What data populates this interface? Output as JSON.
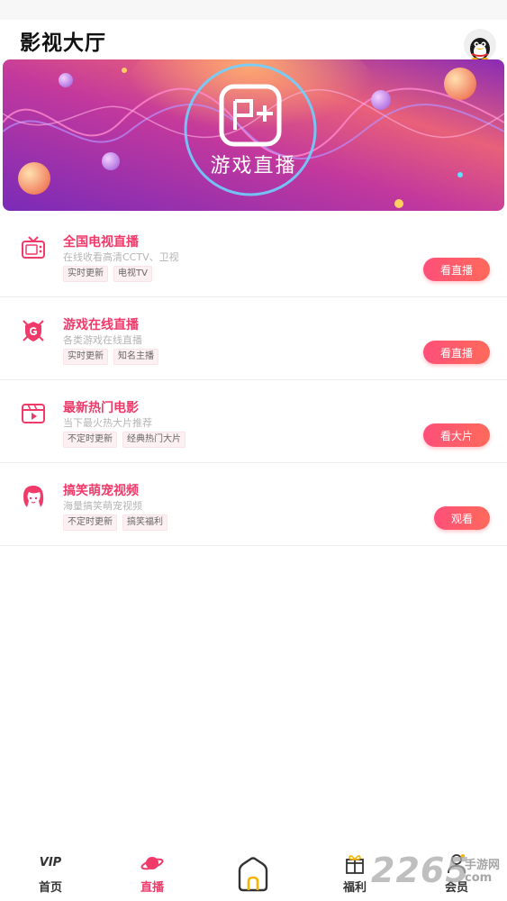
{
  "header": {
    "title": "影视大厅",
    "avatar_icon": "penguin-avatar-icon"
  },
  "banner": {
    "logo_text": "游戏直播",
    "colors": {
      "start": "#8e2bbd",
      "mid": "#c23a9a",
      "end": "#f28a5a"
    }
  },
  "items": [
    {
      "title": "全国电视直播",
      "subtitle": "在线收看高清CCTV、卫视",
      "tags": [
        "实时更新",
        "电视TV"
      ],
      "button": "看直播",
      "icon": "tv-icon"
    },
    {
      "title": "游戏在线直播",
      "subtitle": "各类游戏在线直播",
      "tags": [
        "实时更新",
        "知名主播"
      ],
      "button": "看直播",
      "icon": "game-shield-icon"
    },
    {
      "title": "最新热门电影",
      "subtitle": "当下最火热大片推荐",
      "tags": [
        "不定时更新",
        "经典热门大片"
      ],
      "button": "看大片",
      "icon": "film-icon"
    },
    {
      "title": "搞笑萌宠视频",
      "subtitle": "海量搞笑萌宠视频",
      "tags": [
        "不定时更新",
        "搞笑福利"
      ],
      "button": "观看",
      "icon": "girl-face-icon"
    }
  ],
  "nav": {
    "home_label": "首页",
    "live_label": "直播",
    "welfare_label": "福利",
    "member_label": "会员",
    "vip_text": "VIP"
  },
  "watermark": {
    "number": "2265",
    "top_text": "手游网",
    "bottom_text": "com"
  },
  "colors": {
    "accent": "#ef3a6a",
    "button_start": "#ff4f7a",
    "button_end": "#ff6a5a"
  }
}
